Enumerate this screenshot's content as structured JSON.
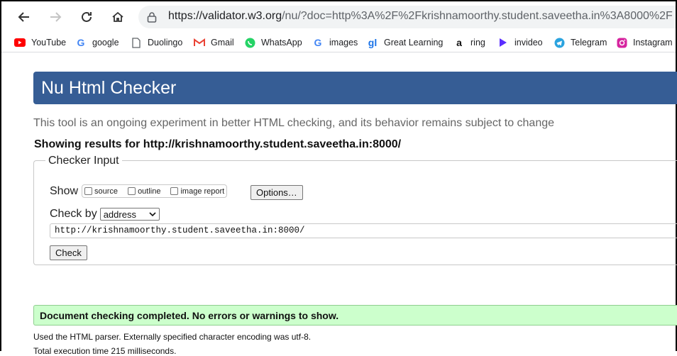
{
  "browser": {
    "url_host": "https://validator.w3.org",
    "url_rest": "/nu/?doc=http%3A%2F%2Fkrishnamoorthy.student.saveetha.in%3A8000%2F",
    "bookmarks": [
      {
        "label": "YouTube",
        "icon": "youtube-icon",
        "color": "#ff0000"
      },
      {
        "label": "google",
        "icon": "google-icon",
        "color": "#4285f4"
      },
      {
        "label": "Duolingo",
        "icon": "document-icon",
        "color": "#5f6368"
      },
      {
        "label": "Gmail",
        "icon": "gmail-icon",
        "color": "#ea4335"
      },
      {
        "label": "WhatsApp",
        "icon": "whatsapp-icon",
        "color": "#25d366"
      },
      {
        "label": "images",
        "icon": "google-icon",
        "color": "#4285f4"
      },
      {
        "label": "Great Learning",
        "icon": "great-learning-icon",
        "color": "#1a73e8"
      },
      {
        "label": "ring",
        "icon": "amazon-icon",
        "color": "#111111"
      },
      {
        "label": "invideo",
        "icon": "invideo-icon",
        "color": "#5b2eff"
      },
      {
        "label": "Telegram",
        "icon": "telegram-icon",
        "color": "#2aa3df"
      },
      {
        "label": "Instagram",
        "icon": "instagram-icon",
        "color": "#d6249f"
      }
    ]
  },
  "page": {
    "title": "Nu Html Checker",
    "subtitle": "This tool is an ongoing experiment in better HTML checking, and its behavior remains subject to change",
    "results_for": "Showing results for http://krishnamoorthy.student.saveetha.in:8000/",
    "checker": {
      "legend": "Checker Input",
      "show_label": "Show",
      "options": [
        "source",
        "outline",
        "image report"
      ],
      "options_button": "Options…",
      "check_by_label": "Check by",
      "check_by_value": "address",
      "input_value": "http://krishnamoorthy.student.saveetha.in:8000/",
      "check_button": "Check"
    },
    "success_message": "Document checking completed. No errors or warnings to show.",
    "parser_note": "Used the HTML parser. Externally specified character encoding was utf-8.",
    "exec_time": "Total execution time 215 milliseconds."
  },
  "colors": {
    "banner": "#365d95",
    "success_bg": "#ccffcc"
  }
}
